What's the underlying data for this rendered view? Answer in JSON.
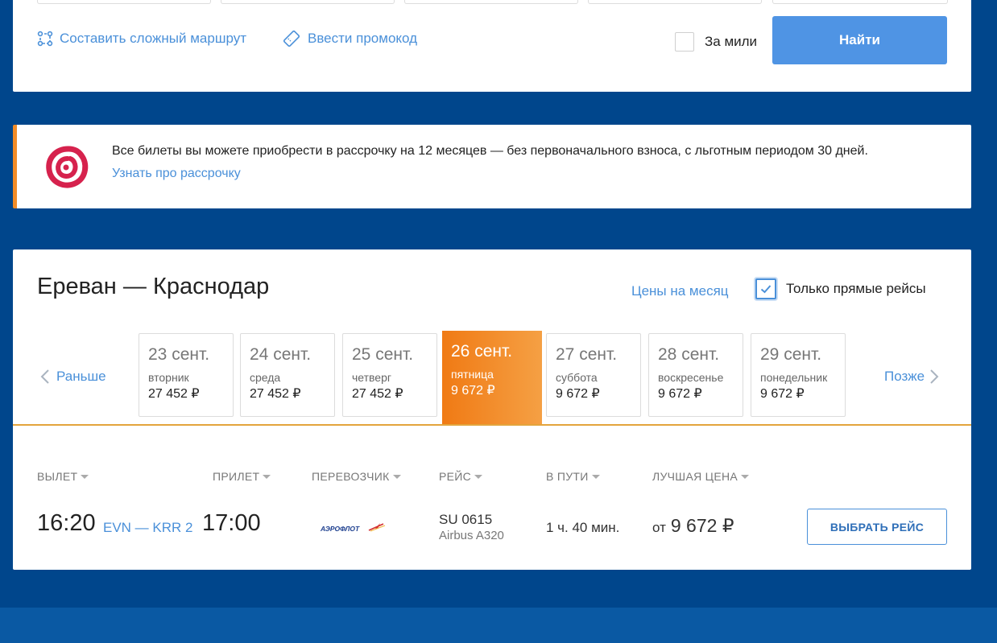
{
  "search": {
    "complex_route_label": "Составить сложный маршрут",
    "promo_label": "Ввести промокод",
    "miles_label": "За мили",
    "find_button": "Найти"
  },
  "installment": {
    "text": "Все билеты вы можете приобрести в рассрочку на 12 месяцев — без первоначального взноса, с льготным периодом 30 дней.",
    "link": "Узнать про рассрочку"
  },
  "results": {
    "route_title": "Ереван — Краснодар",
    "month_prices_link": "Цены на месяц",
    "direct_only_label": "Только прямые рейсы",
    "direct_only_checked": true,
    "earlier_label": "Раньше",
    "later_label": "Позже",
    "dates": [
      {
        "date": "23 сент.",
        "weekday": "вторник",
        "price": "27 452 ₽",
        "active": false
      },
      {
        "date": "24 сент.",
        "weekday": "среда",
        "price": "27 452 ₽",
        "active": false
      },
      {
        "date": "25 сент.",
        "weekday": "четверг",
        "price": "27 452 ₽",
        "active": false
      },
      {
        "date": "26 сент.",
        "weekday": "пятница",
        "price": "9 672 ₽",
        "active": true
      },
      {
        "date": "27 сент.",
        "weekday": "суббота",
        "price": "9 672 ₽",
        "active": false
      },
      {
        "date": "28 сент.",
        "weekday": "воскресенье",
        "price": "9 672 ₽",
        "active": false
      },
      {
        "date": "29 сент.",
        "weekday": "понедельник",
        "price": "9 672 ₽",
        "active": false
      }
    ],
    "columns": {
      "departure": "ВЫЛЕТ",
      "arrival": "ПРИЛЕТ",
      "carrier": "ПЕРЕВОЗЧИК",
      "flight": "РЕЙС",
      "duration": "В ПУТИ",
      "best_price": "ЛУЧШАЯ ЦЕНА"
    },
    "flight": {
      "departure_time": "16:20",
      "route": "EVN — KRR 2",
      "arrival_time": "17:00",
      "carrier_name": "АЭРОФЛОТ",
      "flight_number": "SU 0615",
      "aircraft": "Airbus A320",
      "duration": "1 ч. 40 мин.",
      "price_prefix": "от",
      "price": "9 672 ₽",
      "choose_button": "ВЫБРАТЬ РЕЙС"
    }
  },
  "colors": {
    "page_background": "#00468c",
    "accent_blue": "#4f94e4",
    "link_blue": "#4a90d9",
    "active_date_orange": "#f07a14",
    "installment_stripe": "#f28c28"
  }
}
